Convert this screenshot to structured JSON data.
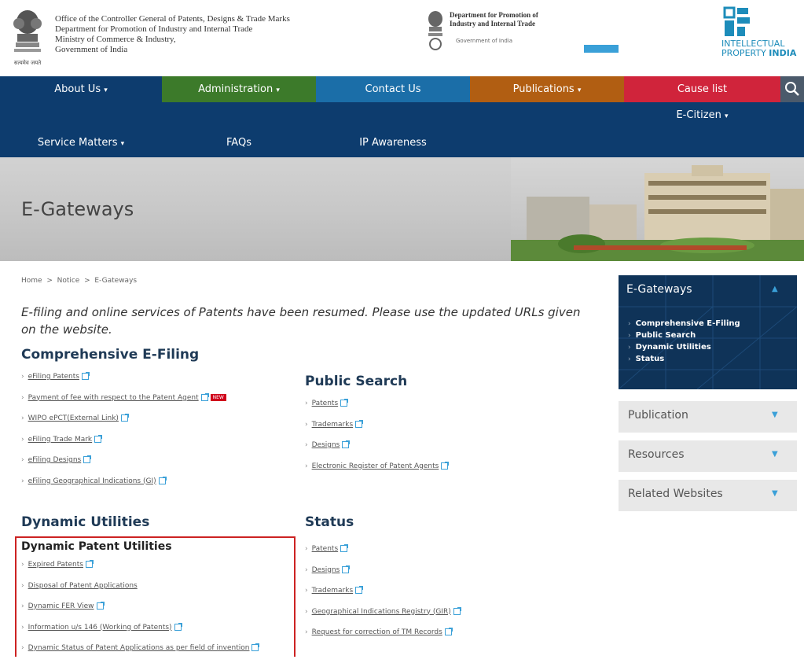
{
  "header": {
    "emblem_caption": "सत्यमेव जयते",
    "office_lines": [
      "Office of the Controller General of Patents, Designs & Trade Marks",
      "Department for Promotion of Industry and Internal Trade",
      "Ministry of Commerce & Industry,",
      "Government of India"
    ],
    "dept_lines": [
      "Department for Promotion of",
      "Industry and Internal Trade"
    ],
    "dept_sub": "Government of India",
    "ipi_line1": "INTELLECTUAL",
    "ipi_line2a": "PROPERTY ",
    "ipi_line2b": "INDIA"
  },
  "nav": {
    "row1": [
      {
        "label": "About Us",
        "caret": true,
        "color": "#0d3c6e"
      },
      {
        "label": "Administration",
        "caret": true,
        "color": "#3c7a2a"
      },
      {
        "label": "Contact Us",
        "caret": false,
        "color": "#1b6ea8"
      },
      {
        "label": "Publications",
        "caret": true,
        "color": "#b15e12"
      },
      {
        "label": "Cause list",
        "caret": false,
        "color": "#d0243b"
      }
    ],
    "ecitizen": "E-Citizen",
    "row3": [
      "Service Matters",
      "FAQs",
      "IP Awareness"
    ]
  },
  "banner": {
    "title": "E-Gateways"
  },
  "breadcrumb": {
    "home": "Home",
    "notice": "Notice",
    "current": "E-Gateways",
    "sep": ">"
  },
  "notice_text": "E-filing and online services of Patents have been resumed. Please use the updated URLs given on the website.",
  "comprehensive": {
    "title": "Comprehensive E-Filing",
    "items": [
      "eFiling Patents",
      "Payment of fee with respect to the Patent Agent",
      "WIPO ePCT(External Link)",
      "eFiling Trade Mark",
      "eFiling Designs",
      "eFiling Geographical Indications (GI)"
    ],
    "new_label": "NEW"
  },
  "public_search": {
    "title": "Public Search",
    "items": [
      "Patents",
      "Trademarks",
      "Designs",
      "Electronic Register of Patent Agents"
    ]
  },
  "dynamic": {
    "title": "Dynamic Utilities",
    "subtitle": "Dynamic Patent Utilities",
    "items": [
      "Expired Patents",
      "Disposal of Patent Applications",
      "Dynamic FER View",
      "Information u/s 146 (Working of Patents)",
      "Dynamic Status of Patent Applications as per field of invention"
    ]
  },
  "status": {
    "title": "Status",
    "items": [
      "Patents",
      "Designs",
      "Trademarks",
      "Geographical Indications Registry (GIR)",
      "Request for correction of TM Records"
    ]
  },
  "sidebar": {
    "title": "E-Gateways",
    "links": [
      "Comprehensive E-Filing",
      "Public Search",
      "Dynamic Utilities",
      "Status"
    ],
    "accordions": [
      "Publication",
      "Resources",
      "Related Websites"
    ]
  }
}
